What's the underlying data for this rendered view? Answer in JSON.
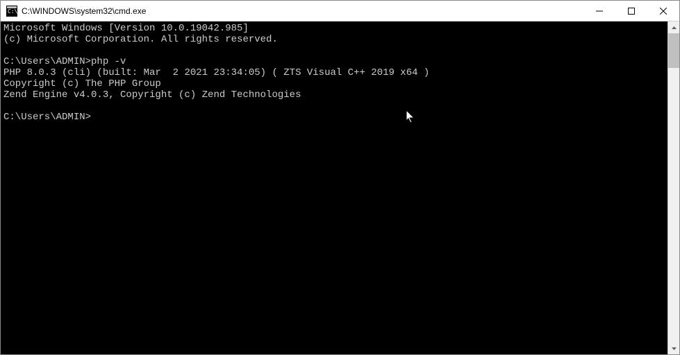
{
  "window": {
    "title": "C:\\WINDOWS\\system32\\cmd.exe"
  },
  "terminal": {
    "lines": [
      "Microsoft Windows [Version 10.0.19042.985]",
      "(c) Microsoft Corporation. All rights reserved.",
      "",
      "C:\\Users\\ADMIN>php -v",
      "PHP 8.0.3 (cli) (built: Mar  2 2021 23:34:05) ( ZTS Visual C++ 2019 x64 )",
      "Copyright (c) The PHP Group",
      "Zend Engine v4.0.3, Copyright (c) Zend Technologies",
      "",
      "C:\\Users\\ADMIN>"
    ]
  }
}
